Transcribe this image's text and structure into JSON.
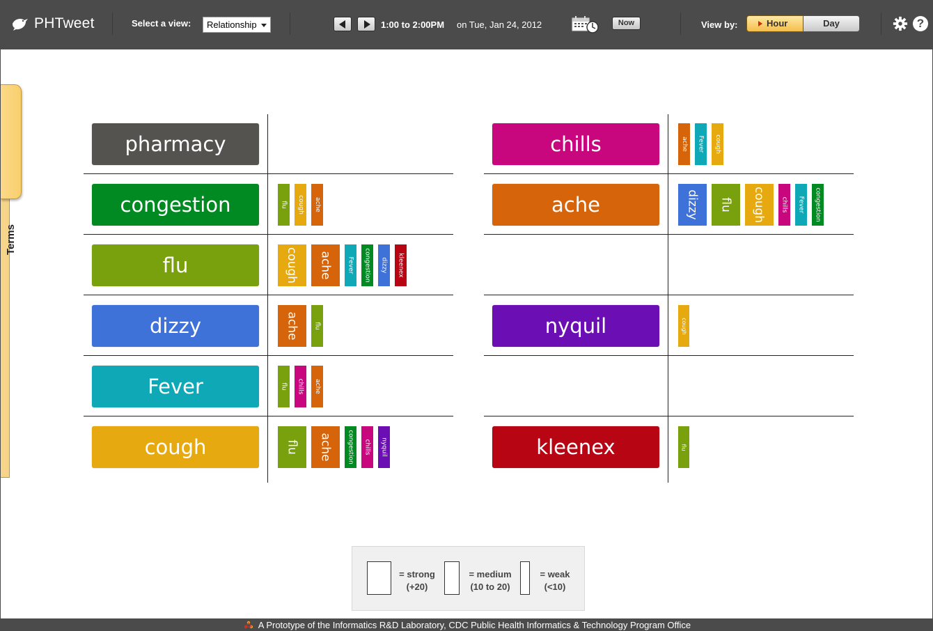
{
  "header": {
    "app_title": "PHTweet",
    "view_label": "Select a view:",
    "view_selected": "Relationship",
    "time_range": "1:00 to 2:00PM",
    "date_text": "on Tue, Jan 24, 2012",
    "now_label": "Now",
    "viewby_label": "View by:",
    "hour_label": "Hour",
    "day_label": "Day",
    "help_label": "?"
  },
  "side_tab": {
    "label": "Terms"
  },
  "colors": {
    "pharmacy": "#545350",
    "congestion": "#028a22",
    "flu": "#78a10d",
    "dizzy": "#3f72d9",
    "Fever": "#0fa8b6",
    "cough": "#e6a90f",
    "chills": "#c8077f",
    "ache": "#d6640a",
    "nyquil": "#6b0eb3",
    "kleenex": "#b70514"
  },
  "terms": [
    {
      "name": "pharmacy",
      "related": []
    },
    {
      "name": "congestion",
      "related": [
        {
          "term": "flu",
          "strength": "medium"
        },
        {
          "term": "cough",
          "strength": "medium"
        },
        {
          "term": "ache",
          "strength": "medium"
        }
      ]
    },
    {
      "name": "flu",
      "related": [
        {
          "term": "cough",
          "strength": "strong"
        },
        {
          "term": "ache",
          "strength": "strong"
        },
        {
          "term": "Fever",
          "strength": "medium"
        },
        {
          "term": "congestion",
          "strength": "medium"
        },
        {
          "term": "dizzy",
          "strength": "medium"
        },
        {
          "term": "kleenex",
          "strength": "medium"
        }
      ]
    },
    {
      "name": "dizzy",
      "related": [
        {
          "term": "ache",
          "strength": "strong"
        },
        {
          "term": "flu",
          "strength": "medium"
        }
      ]
    },
    {
      "name": "Fever",
      "related": [
        {
          "term": "flu",
          "strength": "medium"
        },
        {
          "term": "chills",
          "strength": "medium"
        },
        {
          "term": "ache",
          "strength": "medium"
        }
      ]
    },
    {
      "name": "cough",
      "related": [
        {
          "term": "flu",
          "strength": "strong"
        },
        {
          "term": "ache",
          "strength": "strong"
        },
        {
          "term": "congestion",
          "strength": "medium"
        },
        {
          "term": "chills",
          "strength": "medium"
        },
        {
          "term": "nyquil",
          "strength": "medium"
        }
      ]
    },
    {
      "name": "chills",
      "related": [
        {
          "term": "ache",
          "strength": "medium"
        },
        {
          "term": "Fever",
          "strength": "medium"
        },
        {
          "term": "cough",
          "strength": "medium"
        }
      ]
    },
    {
      "name": "ache",
      "related": [
        {
          "term": "dizzy",
          "strength": "strong"
        },
        {
          "term": "flu",
          "strength": "strong"
        },
        {
          "term": "cough",
          "strength": "strong"
        },
        {
          "term": "chills",
          "strength": "medium"
        },
        {
          "term": "Fever",
          "strength": "medium"
        },
        {
          "term": "congestion",
          "strength": "medium"
        }
      ]
    },
    {
      "name": "",
      "related": []
    },
    {
      "name": "nyquil",
      "related": [
        {
          "term": "cough",
          "strength": "weak"
        }
      ]
    },
    {
      "name": "",
      "related": []
    },
    {
      "name": "kleenex",
      "related": [
        {
          "term": "flu",
          "strength": "weak"
        }
      ]
    }
  ],
  "legend": {
    "strong": "= strong\n(+20)",
    "medium": "= medium\n(10 to 20)",
    "weak": "= weak\n(<10)"
  },
  "footer": {
    "text": "A Prototype of the Informatics R&D Laboratory, CDC Public Health Informatics & Technology Program Office"
  }
}
